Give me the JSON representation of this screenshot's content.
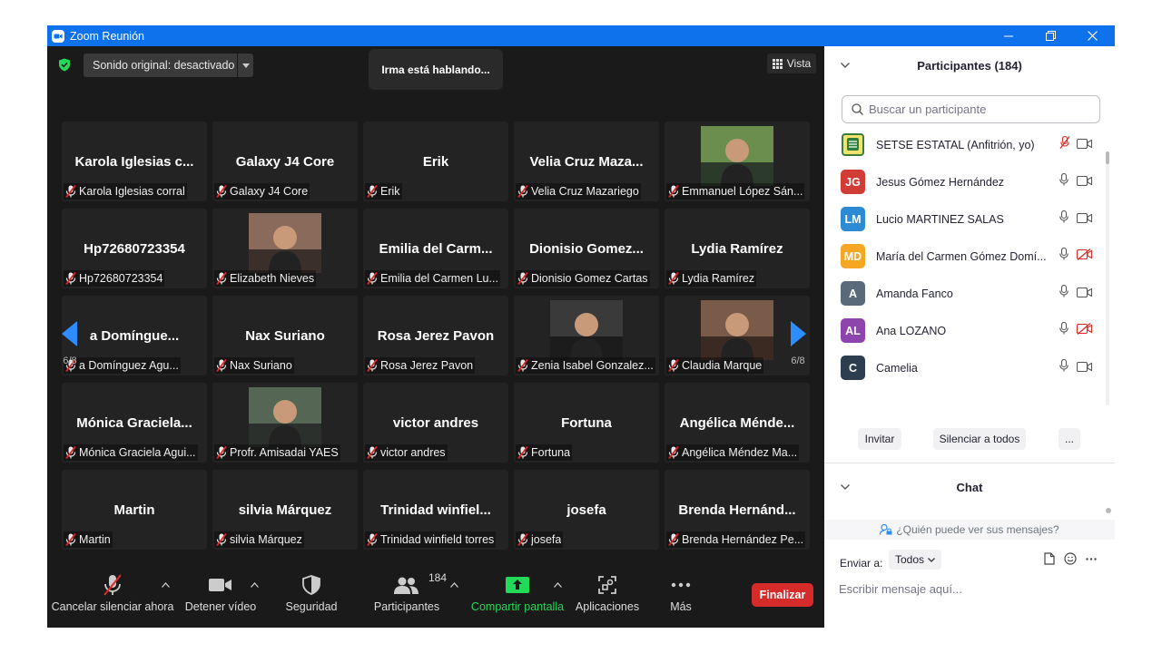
{
  "window": {
    "title": "Zoom Reunión"
  },
  "topbar": {
    "audio_label": "Sonido original: desactivado",
    "speaking": "Irma está hablando...",
    "view_label": "Vista"
  },
  "grid": {
    "page_left": "6/8",
    "page_right": "6/8",
    "tiles": [
      {
        "display": "Karola Iglesias c...",
        "label": "Karola Iglesias corral",
        "photo": false
      },
      {
        "display": "Galaxy J4 Core",
        "label": "Galaxy J4 Core",
        "photo": false
      },
      {
        "display": "Erik",
        "label": "Erik",
        "photo": false
      },
      {
        "display": "Velia Cruz Maza...",
        "label": "Velia Cruz Mazariego",
        "photo": false
      },
      {
        "display": "",
        "label": "Emmanuel López Sán...",
        "photo": true
      },
      {
        "display": "Hp72680723354",
        "label": "Hp72680723354",
        "photo": false
      },
      {
        "display": "",
        "label": "Elizabeth Nieves",
        "photo": true
      },
      {
        "display": "Emilia del Carm...",
        "label": "Emilia del Carmen Lu...",
        "photo": false
      },
      {
        "display": "Dionisio Gomez...",
        "label": "Dionisio Gomez Cartas",
        "photo": false
      },
      {
        "display": "Lydia Ramírez",
        "label": "Lydia Ramírez",
        "photo": false
      },
      {
        "display": "a Domíngue...",
        "label": "a Domínguez Agu...",
        "photo": false
      },
      {
        "display": "Nax Suriano",
        "label": "Nax Suriano",
        "photo": false
      },
      {
        "display": "Rosa Jerez Pavon",
        "label": "Rosa Jerez Pavon",
        "photo": false
      },
      {
        "display": "",
        "label": "Zenia Isabel Gonzalez...",
        "photo": true
      },
      {
        "display": "",
        "label": "Claudia Marque",
        "photo": true
      },
      {
        "display": "Mónica Graciela...",
        "label": "Mónica Graciela Agui...",
        "photo": false
      },
      {
        "display": "",
        "label": "Profr. Amisadai YAES",
        "photo": true
      },
      {
        "display": "victor andres",
        "label": "victor andres",
        "photo": false
      },
      {
        "display": "Fortuna",
        "label": "Fortuna",
        "photo": false
      },
      {
        "display": "Angélica Ménde...",
        "label": "Angélica Méndez Ma...",
        "photo": false
      },
      {
        "display": "Martin",
        "label": "Martin",
        "photo": false
      },
      {
        "display": "silvia Márquez",
        "label": "silvia Márquez",
        "photo": false
      },
      {
        "display": "Trinidad winfiel...",
        "label": "Trinidad winfield torres",
        "photo": false
      },
      {
        "display": "josefa",
        "label": "josefa",
        "photo": false
      },
      {
        "display": "Brenda Hernánd...",
        "label": "Brenda Hernández Pe...",
        "photo": false
      }
    ]
  },
  "toolbar": {
    "unmute": "Cancelar silenciar ahora",
    "stop_video": "Detener vídeo",
    "security": "Seguridad",
    "participants": "Participantes",
    "participants_count": "184",
    "share": "Compartir pantalla",
    "apps": "Aplicaciones",
    "more": "Más",
    "end": "Finalizar",
    "share_color": "#23d959",
    "end_color": "#d52b2b"
  },
  "panel": {
    "title": "Participantes (184)",
    "search_placeholder": "Buscar un participante",
    "participants": [
      {
        "initials": "",
        "name": "SETSE ESTATAL (Anfitrión, yo)",
        "color": "#ffffff",
        "mic": "muted",
        "cam": "on"
      },
      {
        "initials": "JG",
        "name": "Jesus Gómez Hernández",
        "color": "#d23c37",
        "mic": "on",
        "cam": "on"
      },
      {
        "initials": "LM",
        "name": "Lucio MARTINEZ SALAS",
        "color": "#2d8bd6",
        "mic": "on",
        "cam": "on"
      },
      {
        "initials": "MD",
        "name": "María del Carmen Gómez Domí...",
        "color": "#f5a623",
        "mic": "on",
        "cam": "off"
      },
      {
        "initials": "A",
        "name": "Amanda Fanco",
        "color": "#5a6a7a",
        "mic": "on",
        "cam": "on"
      },
      {
        "initials": "AL",
        "name": "Ana LOZANO",
        "color": "#8e44ad",
        "mic": "on",
        "cam": "off"
      },
      {
        "initials": "C",
        "name": "Camelia",
        "color": "#2c3e50",
        "mic": "on",
        "cam": "on"
      }
    ],
    "invite": "Invitar",
    "mute_all": "Silenciar a todos",
    "more": "...",
    "chat_title": "Chat",
    "chat_who": "¿Quién puede ver sus mensajes?",
    "send_to_label": "Enviar a:",
    "send_to_value": "Todos",
    "message_placeholder": "Escribir mensaje aquí..."
  }
}
